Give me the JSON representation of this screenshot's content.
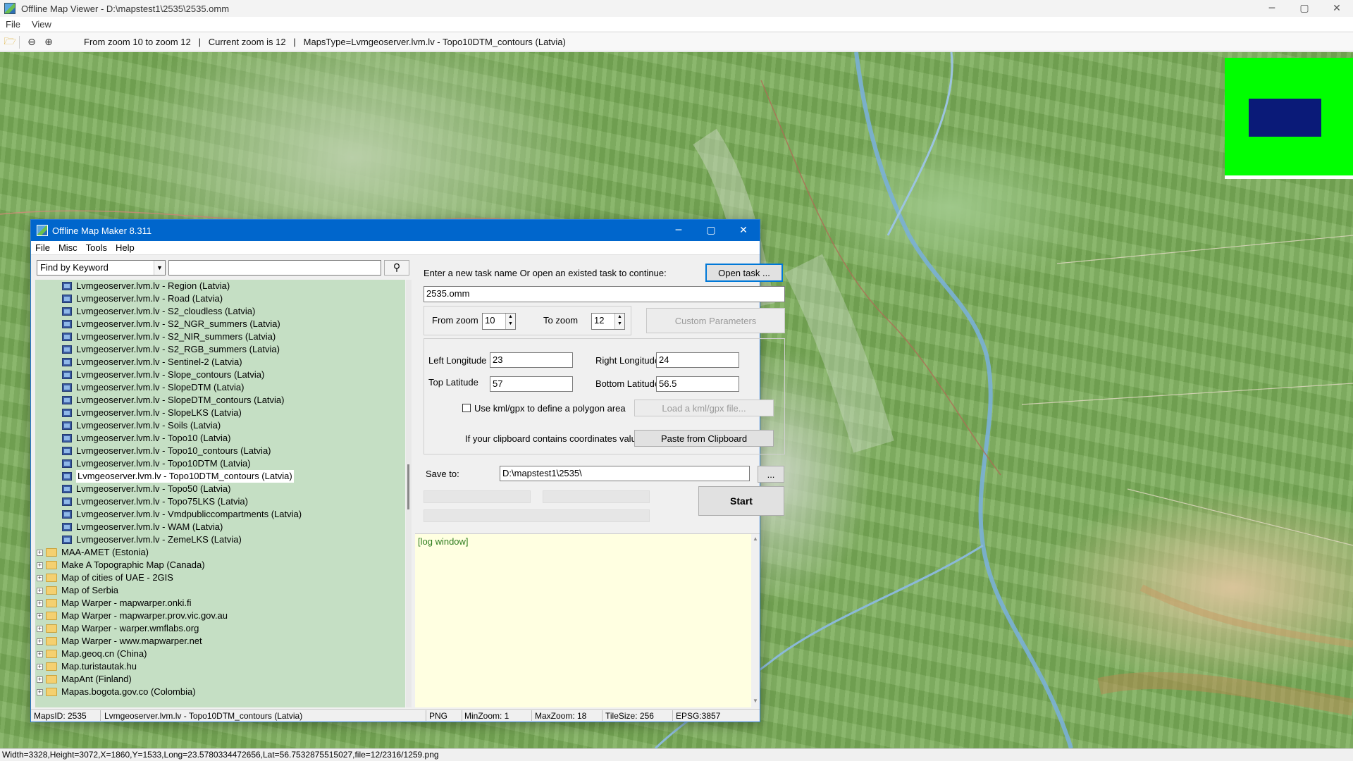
{
  "window": {
    "title": "Offline Map Viewer - D:\\mapstest1\\2535\\2535.omm",
    "controls": {
      "minimize": "─",
      "maximize": "▢",
      "close": "✕"
    }
  },
  "menubar": [
    "File",
    "View"
  ],
  "toolbar": {
    "icons": [
      "open-folder-icon",
      "zoom-out-icon",
      "zoom-in-icon"
    ],
    "status": "From zoom 10 to zoom 12   |   Current zoom is 12   |   MapsType=Lvmgeoserver.lvm.lv - Topo10DTM_contours (Latvia)"
  },
  "map": {
    "overview_colors": {
      "background": "#00ff00",
      "viewport": "#0a1a78"
    }
  },
  "status_bar": {
    "text": "Width=3328,Height=3072,X=1860,Y=1533,Long=23.5780334472656,Lat=56.7532875515027,file=12/2316/1259.png"
  },
  "dialog": {
    "title": "Offline Map Maker 8.311",
    "controls": {
      "minimize": "─",
      "maximize": "▢",
      "close": "✕"
    },
    "menu": [
      "File",
      "Misc",
      "Tools",
      "Help"
    ],
    "search": {
      "mode": "Find by Keyword",
      "input_value": "",
      "button_icon": "search-icon"
    },
    "tree": {
      "children": [
        "Lvmgeoserver.lvm.lv - Region (Latvia)",
        "Lvmgeoserver.lvm.lv - Road (Latvia)",
        "Lvmgeoserver.lvm.lv - S2_cloudless (Latvia)",
        "Lvmgeoserver.lvm.lv - S2_NGR_summers (Latvia)",
        "Lvmgeoserver.lvm.lv - S2_NIR_summers (Latvia)",
        "Lvmgeoserver.lvm.lv - S2_RGB_summers (Latvia)",
        "Lvmgeoserver.lvm.lv - Sentinel-2 (Latvia)",
        "Lvmgeoserver.lvm.lv - Slope_contours (Latvia)",
        "Lvmgeoserver.lvm.lv - SlopeDTM (Latvia)",
        "Lvmgeoserver.lvm.lv - SlopeDTM_contours (Latvia)",
        "Lvmgeoserver.lvm.lv - SlopeLKS (Latvia)",
        "Lvmgeoserver.lvm.lv - Soils (Latvia)",
        "Lvmgeoserver.lvm.lv - Topo10 (Latvia)",
        "Lvmgeoserver.lvm.lv - Topo10_contours (Latvia)",
        "Lvmgeoserver.lvm.lv - Topo10DTM (Latvia)",
        "Lvmgeoserver.lvm.lv - Topo10DTM_contours (Latvia)",
        "Lvmgeoserver.lvm.lv - Topo50 (Latvia)",
        "Lvmgeoserver.lvm.lv - Topo75LKS (Latvia)",
        "Lvmgeoserver.lvm.lv - Vmdpubliccompartments (Latvia)",
        "Lvmgeoserver.lvm.lv - WAM (Latvia)",
        "Lvmgeoserver.lvm.lv - ZemeLKS (Latvia)"
      ],
      "selected_index": 15,
      "groups": [
        "MAA-AMET (Estonia)",
        "Make A Topographic Map (Canada)",
        "Map of cities of UAE - 2GIS",
        "Map of Serbia",
        "Map Warper - mapwarper.onki.fi",
        "Map Warper - mapwarper.prov.vic.gov.au",
        "Map Warper - warper.wmflabs.org",
        "Map Warper - www.mapwarper.net",
        "Map.geoq.cn (China)",
        "Map.turistautak.hu",
        "MapAnt (Finland)",
        "Mapas.bogota.gov.co (Colombia)"
      ],
      "expander_symbol": "+"
    },
    "task": {
      "prompt": "Enter a new task name Or open an existed task to continue:",
      "open_button": "Open task ...",
      "name_value": "2535.omm"
    },
    "zoom": {
      "from_label": "From zoom",
      "from_value": "10",
      "to_label": "To zoom",
      "to_value": "12",
      "custom_button": "Custom Parameters"
    },
    "bounds": {
      "left_label": "Left Longitude",
      "left_value": "23",
      "right_label": "Right Longitude",
      "right_value": "24",
      "top_label": "Top Latitude",
      "top_value": "57",
      "bottom_label": "Bottom Latitude",
      "bottom_value": "56.5",
      "kml_label": "Use kml/gpx to define a polygon area",
      "kml_checked": false,
      "kml_button": "Load a kml/gpx file...",
      "clipboard_label": "If your clipboard contains coordinates values:",
      "clipboard_button": "Paste from Clipboard"
    },
    "save": {
      "label": "Save to:",
      "path": "D:\\mapstest1\\2535\\",
      "browse_button": "...",
      "start_button": "Start"
    },
    "log": {
      "text": "[log window]"
    },
    "status": {
      "maps_id": "MapsID: 2535",
      "map_name": "Lvmgeoserver.lvm.lv - Topo10DTM_contours (Latvia)",
      "format": "PNG",
      "min_zoom": "MinZoom: 1",
      "max_zoom": "MaxZoom: 18",
      "tile_size": "TileSize: 256",
      "epsg": "EPSG:3857"
    }
  }
}
